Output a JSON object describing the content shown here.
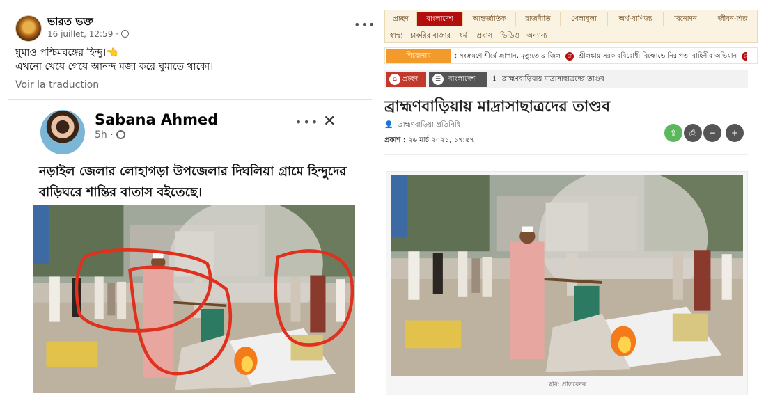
{
  "facebook_post": {
    "author": "ভারত ভক্ত",
    "timestamp": "16 juillet, 12:59 ·",
    "more_label": "•••",
    "text_line1": "ঘুমাও পশ্চিমবঙ্গের হিন্দু।👈",
    "text_line2": "এখনো খেয়ে গেয়ে আনন্দ মজা করে ঘুমাতে থাকো।",
    "translate_link": "Voir la traduction",
    "shared": {
      "author": "Sabana Ahmed",
      "time": "5h ·",
      "more_label": "•••",
      "close_label": "✕",
      "text": "নড়াইল জেলার লোহাগড়া উপজেলার দিঘলিয়া গ্রামে হিন্দুদের বাড়িঘরে শান্তির বাতাস বইতেছে।"
    }
  },
  "news_site": {
    "nav_row1": [
      "প্রচ্ছদ",
      "বাংলাদেশ",
      "আন্তর্জাতিক",
      "রাজনীতি",
      "খেলাধুলা",
      "অর্থ-বাণিজ্য",
      "বিনোদন",
      "জীবন-শিল্প"
    ],
    "nav_row2": [
      "স্বাস্থ্য",
      "চাকরির বাজার",
      "ধর্ম",
      "প্রবাস",
      "ভিডিও",
      "অন্যান্য"
    ],
    "active_nav": "বাংলাদেশ",
    "ticker_label": "শিরোনাম",
    "ticker_item1": ": সংক্রমণে শীর্ষে জাপান, মৃত্যুতে ব্রাজিল",
    "ticker_item2": "শ্রীলঙ্কায় সরকারবিরোধী বিক্ষোভে নিরাপত্তা বাহিনীর অভিযান",
    "ticker_icon": "ঢা",
    "breadcrumb": {
      "home": "প্রচ্ছদ",
      "section": "বাংলাদেশ",
      "current": "ব্রাহ্মণবাড়িয়ায় মাদ্রাসাছাত্রদের তাণ্ডব"
    },
    "headline": "ব্রাহ্মণবাড়িয়ায় মাদ্রাসাছাত্রদের তাণ্ডব",
    "byline": "ব্রাহ্মণবাড়িয়া প্রতিনিধি",
    "published_label": "প্রকাশ :",
    "published_date": "২৬ মার্চ ২০২১, ১৭:৫৭",
    "photo_caption": "ছবি: প্রতিবেদক",
    "colors": {
      "accent": "#b40d0d",
      "ticker": "#f39b2a",
      "share": "#5cb85c",
      "round_btn": "#555555"
    }
  }
}
